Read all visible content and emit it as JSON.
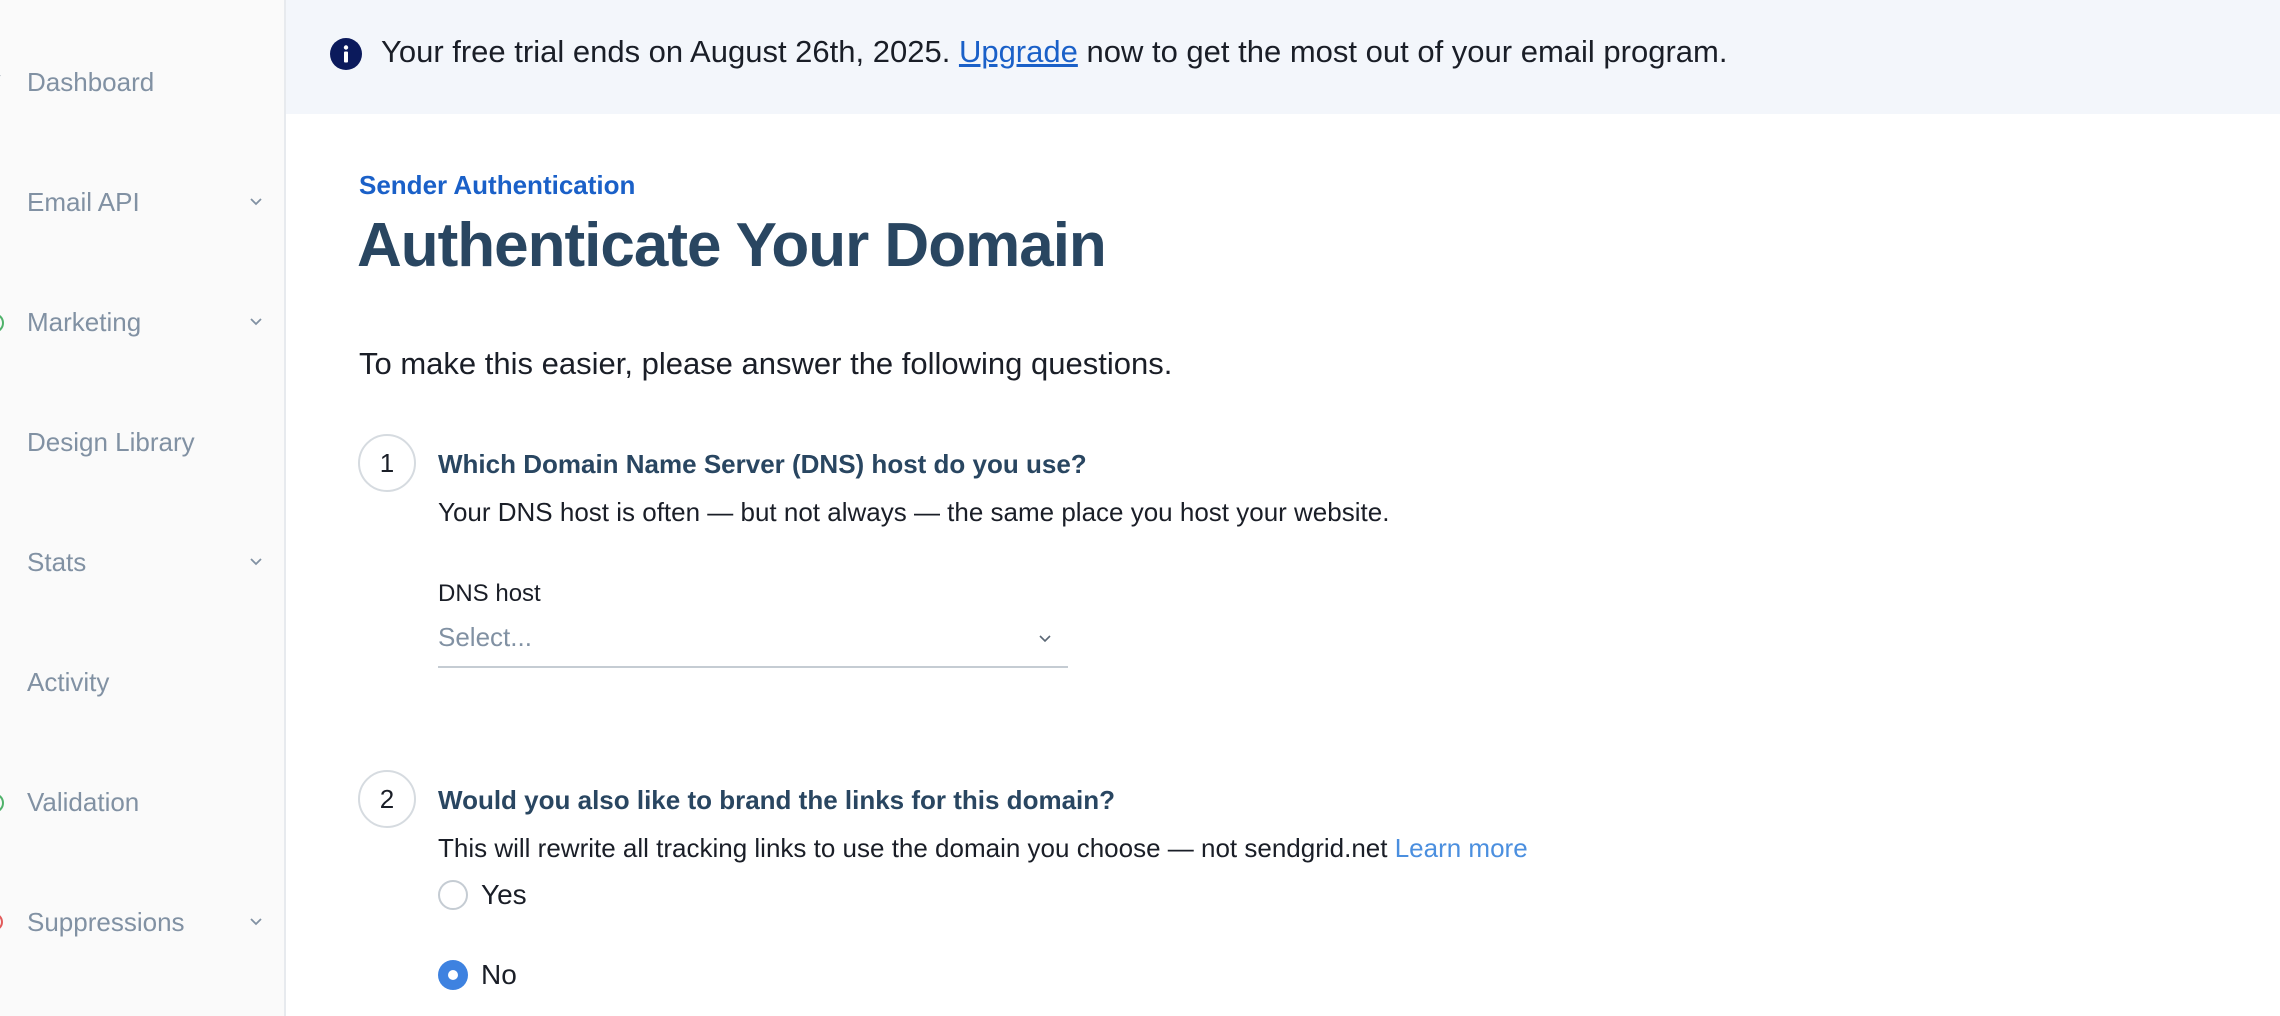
{
  "sidebar": {
    "items": [
      {
        "label": "Dashboard",
        "icon": "home-icon",
        "has_chevron": false,
        "icon_color": "#8191a3"
      },
      {
        "label": "Email API",
        "icon": "email-api-icon",
        "has_chevron": true,
        "icon_color": "#8191a3"
      },
      {
        "label": "Marketing",
        "icon": "marketing-icon",
        "has_chevron": true,
        "icon_color": "#4fb26a"
      },
      {
        "label": "Design Library",
        "icon": "design-library-icon",
        "has_chevron": false,
        "icon_color": "#e25a5a"
      },
      {
        "label": "Stats",
        "icon": "stats-icon",
        "has_chevron": true,
        "icon_color": "#8e5ac4"
      },
      {
        "label": "Activity",
        "icon": "activity-icon",
        "has_chevron": false,
        "icon_color": "#e9a53a"
      },
      {
        "label": "Validation",
        "icon": "validation-icon",
        "has_chevron": false,
        "icon_color": "#4fb26a"
      },
      {
        "label": "Suppressions",
        "icon": "suppressions-icon",
        "has_chevron": true,
        "icon_color": "#e25a5a"
      }
    ]
  },
  "banner": {
    "icon": "info-icon",
    "text_before": "Your free trial ends on August 26th, 2025. ",
    "link_label": "Upgrade",
    "text_after": " now to get the most out of your email program."
  },
  "main": {
    "eyebrow": "Sender Authentication",
    "title": "Authenticate Your Domain",
    "intro": "To make this easier, please answer the following questions.",
    "step1": {
      "number": "1",
      "title": "Which Domain Name Server (DNS) host do you use?",
      "description": "Your DNS host is often — but not always — the same place you host your website.",
      "field_label": "DNS host",
      "select_placeholder": "Select..."
    },
    "step2": {
      "number": "2",
      "title": "Would you also like to brand the links for this domain?",
      "description": "This will rewrite all tracking links to use the domain you choose — not sendgrid.net",
      "learn_more": "Learn more",
      "options": [
        {
          "label": "Yes",
          "checked": false
        },
        {
          "label": "No",
          "checked": true
        }
      ]
    }
  },
  "colors": {
    "accent": "#1a60c8",
    "title": "#294661",
    "radio_checked": "#3e82e0",
    "banner_bg": "#f3f6fb"
  }
}
